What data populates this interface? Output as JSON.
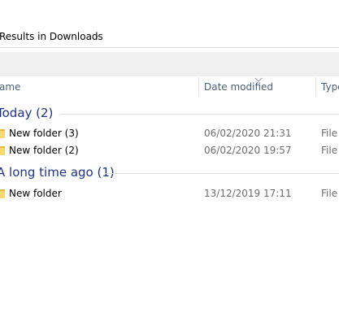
{
  "address": {
    "path_text": "Results in Downloads",
    "chevron": "›"
  },
  "columns": {
    "name": "ame",
    "date_modified": "Date modified",
    "type": "Type"
  },
  "groups": [
    {
      "title": "Today (2)",
      "items": [
        {
          "name": "New folder (3)",
          "date": "06/02/2020 21:31",
          "type": "File f"
        },
        {
          "name": "New folder (2)",
          "date": "06/02/2020 19:57",
          "type": "File f"
        }
      ]
    },
    {
      "title": "A long time ago (1)",
      "items": [
        {
          "name": "New folder",
          "date": "13/12/2019 17:11",
          "type": "File f"
        }
      ]
    }
  ],
  "colors": {
    "group_title": "#1e3287",
    "column_header_text": "#4c607a",
    "secondary_text": "#6d6d6d",
    "folder_yellow": "#f8d775"
  },
  "icons": {
    "folder": "folder-icon",
    "chevron": "chevron-right-icon",
    "sort": "sort-arrow-icon"
  }
}
